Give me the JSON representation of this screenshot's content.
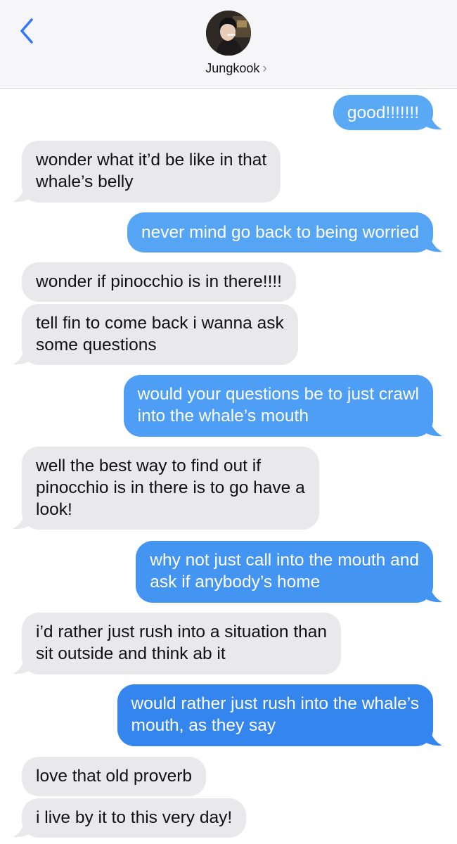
{
  "header": {
    "contact_name": "Jungkook",
    "chevron": "›"
  },
  "messages": [
    {
      "from": "me",
      "text": "good!!!!!!!"
    },
    {
      "from": "them",
      "lines": [
        "wonder what it’d be like in that",
        "whale’s belly"
      ]
    },
    {
      "from": "me",
      "text": "never mind go back to being worried"
    },
    {
      "from": "them",
      "text": "wonder if pinocchio is in there!!!!"
    },
    {
      "from": "them",
      "lines": [
        "tell fin to come back i wanna ask",
        "some questions"
      ]
    },
    {
      "from": "me",
      "lines": [
        "would your questions be to just crawl",
        "into the whale’s mouth"
      ]
    },
    {
      "from": "them",
      "lines": [
        "well the best way to find out if",
        "pinocchio is in there is to go have a",
        "look!"
      ]
    },
    {
      "from": "me",
      "lines": [
        "why not just call into the mouth and",
        "ask if anybody’s home"
      ]
    },
    {
      "from": "them",
      "lines": [
        "i’d rather just rush into a situation than",
        "sit outside and think ab it"
      ]
    },
    {
      "from": "me",
      "lines": [
        "would rather just rush into the whale’s",
        "mouth, as they say"
      ]
    },
    {
      "from": "them",
      "text": "love that old proverb"
    },
    {
      "from": "them",
      "text": "i live by it to this very day!"
    }
  ],
  "colors": {
    "incoming_bg": "#e9e9eb",
    "outgoing_top": "#5aa9f5",
    "outgoing_bottom": "#2f80ef",
    "accent": "#3478f6"
  },
  "icons": [
    "back-chevron-icon",
    "contact-avatar"
  ]
}
